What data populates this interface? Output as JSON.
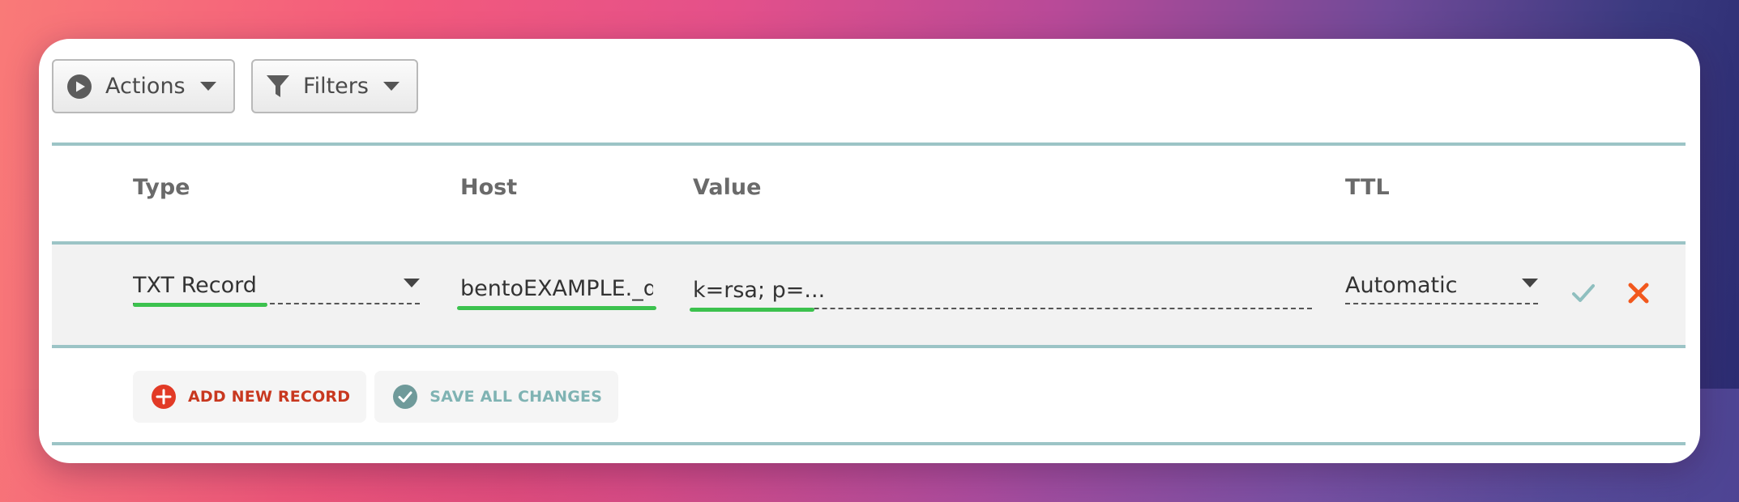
{
  "toolbar": {
    "actions_label": "Actions",
    "filters_label": "Filters"
  },
  "table": {
    "columns": [
      "Type",
      "Host",
      "Value",
      "TTL"
    ]
  },
  "record": {
    "type": "TXT Record",
    "host": "bentoEXAMPLE._d",
    "value": "k=rsa; p=...",
    "ttl": "Automatic"
  },
  "footer": {
    "add_label": "ADD NEW RECORD",
    "save_label": "SAVE ALL CHANGES"
  },
  "colors": {
    "accent_rule": "#9cc4c6",
    "highlight": "#3cc24e",
    "add_red": "#d93b25",
    "cancel_orange": "#f2581d",
    "confirm_teal": "#8fbfbf",
    "save_teal": "#7fb3b3"
  },
  "icons": {
    "actions": "play-circle-icon",
    "filters": "funnel-icon",
    "dropdown": "caret-down-icon",
    "confirm": "checkmark-icon",
    "cancel": "close-x-icon",
    "add": "plus-circle-icon",
    "save": "check-circle-icon"
  }
}
